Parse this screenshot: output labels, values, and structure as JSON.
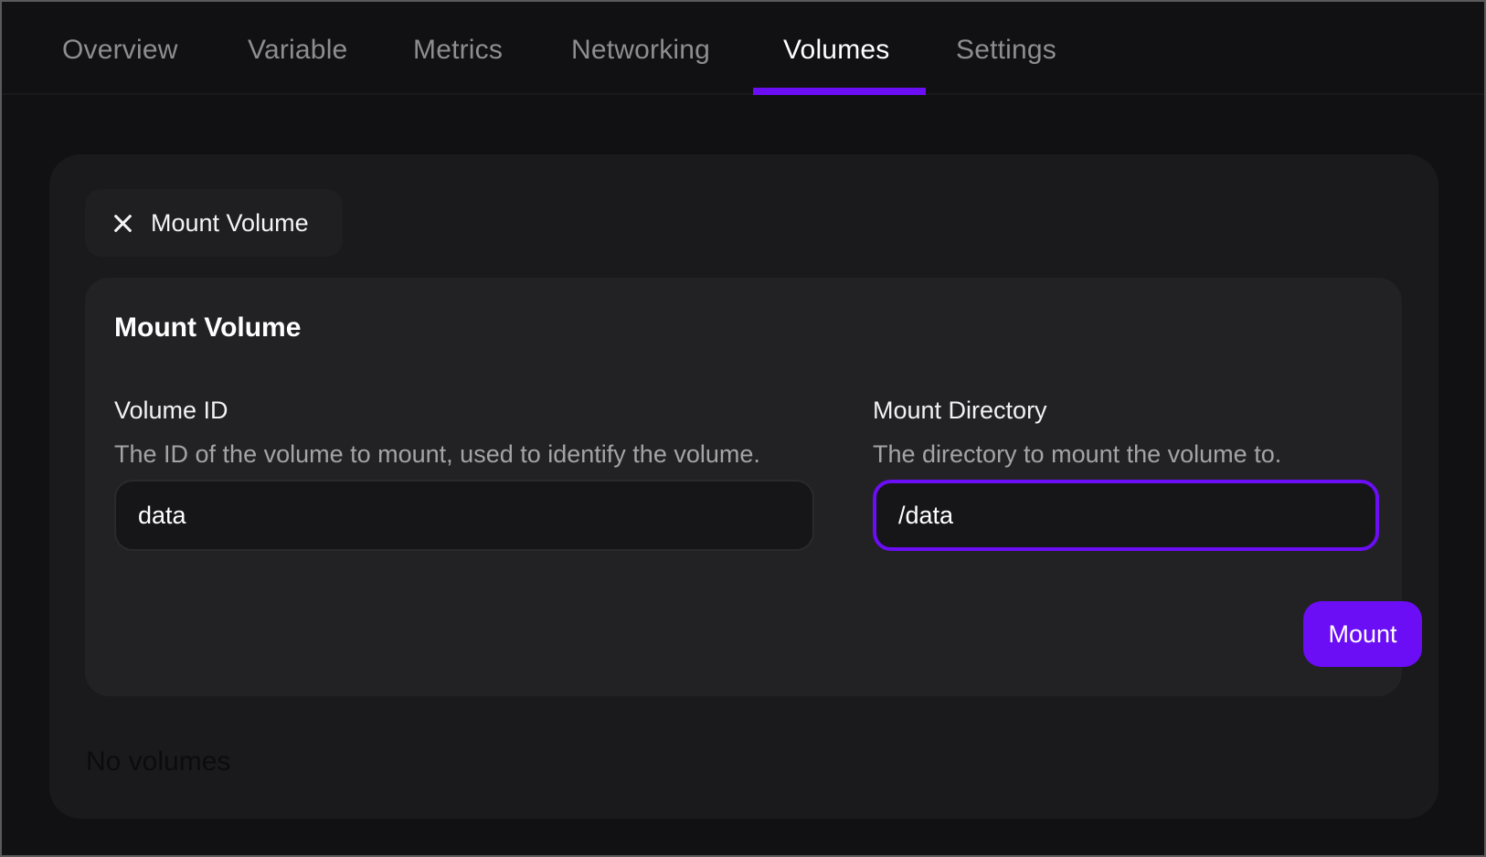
{
  "tabs": [
    {
      "label": "Overview",
      "active": false
    },
    {
      "label": "Variable",
      "active": false
    },
    {
      "label": "Metrics",
      "active": false
    },
    {
      "label": "Networking",
      "active": false
    },
    {
      "label": "Volumes",
      "active": true
    },
    {
      "label": "Settings",
      "active": false
    }
  ],
  "colors": {
    "accent": "#6b0df5",
    "background": "#111113",
    "card": "#1a1a1c",
    "inner_card": "#222224"
  },
  "chip": {
    "icon": "close-icon",
    "label": "Mount Volume"
  },
  "form": {
    "title": "Mount Volume",
    "volume_id": {
      "label": "Volume ID",
      "description": "The ID of the volume to mount, used to identify the volume.",
      "value": "data"
    },
    "mount_directory": {
      "label": "Mount Directory",
      "description": "The directory to mount the volume to.",
      "value": "/data",
      "focused": true
    },
    "submit_label": "Mount"
  },
  "empty_state": "No volumes"
}
